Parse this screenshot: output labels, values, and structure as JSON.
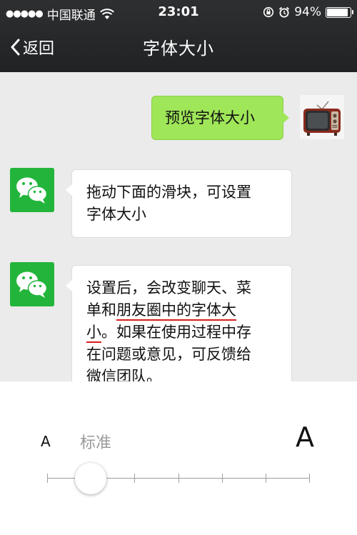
{
  "status_bar": {
    "signal": "●●●●●",
    "carrier": "中国联通",
    "time": "23:01",
    "battery": "94%"
  },
  "nav": {
    "back_label": "返回",
    "title": "字体大小"
  },
  "chat": {
    "messages": [
      {
        "side": "right",
        "text": "预览字体大小",
        "avatar": "tv-icon"
      },
      {
        "side": "left",
        "text_line1": "拖动下面的滑块，可设置",
        "text_line2": "字体大小",
        "avatar": "wechat-icon"
      },
      {
        "side": "left",
        "avatar": "wechat-icon",
        "line1": "设置后，会改变聊天、菜",
        "line2_a": "单和",
        "line2_underlined": "朋友圈中的字体大",
        "line3_underlined": "小",
        "line3_b": "。如果在使用过程中存",
        "line4": "在问题或意见，可反馈给",
        "line5": "微信团队。"
      }
    ]
  },
  "font_panel": {
    "small_label": "A",
    "current_label": "标准",
    "large_label": "A",
    "slider": {
      "levels": 7,
      "selected_index": 1
    }
  },
  "colors": {
    "header_bg": "#2a2b2d",
    "chat_bg": "#ebebeb",
    "bubble_green": "#9fe659",
    "wechat_green": "#23b53b",
    "underline_red": "#d81e1e"
  }
}
